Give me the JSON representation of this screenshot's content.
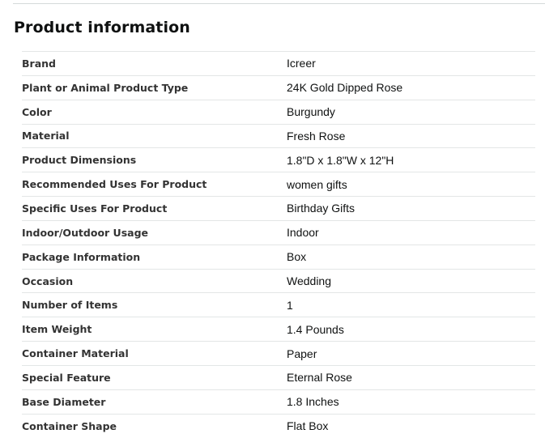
{
  "section": {
    "title": "Product information"
  },
  "rows": [
    {
      "label": "Brand",
      "value": "Icreer"
    },
    {
      "label": "Plant or Animal Product Type",
      "value": "24K Gold Dipped Rose"
    },
    {
      "label": "Color",
      "value": "Burgundy"
    },
    {
      "label": "Material",
      "value": "Fresh Rose"
    },
    {
      "label": "Product Dimensions",
      "value": "1.8\"D x 1.8\"W x 12\"H"
    },
    {
      "label": "Recommended Uses For Product",
      "value": "women gifts"
    },
    {
      "label": "Specific Uses For Product",
      "value": "Birthday Gifts"
    },
    {
      "label": "Indoor/Outdoor Usage",
      "value": "Indoor"
    },
    {
      "label": "Package Information",
      "value": "Box"
    },
    {
      "label": "Occasion",
      "value": "Wedding"
    },
    {
      "label": "Number of Items",
      "value": "1"
    },
    {
      "label": "Item Weight",
      "value": "1.4 Pounds"
    },
    {
      "label": "Container Material",
      "value": "Paper"
    },
    {
      "label": "Special Feature",
      "value": "Eternal Rose"
    },
    {
      "label": "Base Diameter",
      "value": "1.8 Inches"
    },
    {
      "label": "Container Shape",
      "value": "Flat Box"
    }
  ]
}
